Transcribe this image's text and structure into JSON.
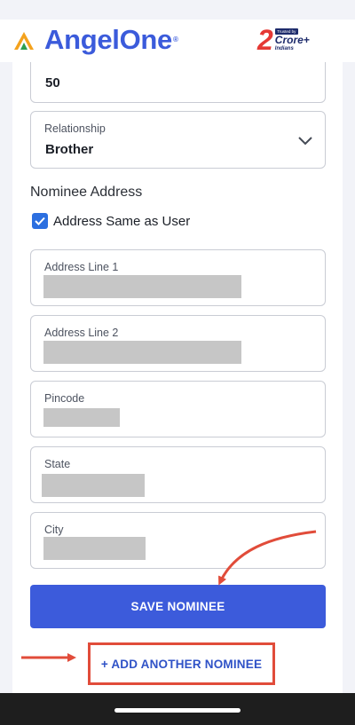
{
  "header": {
    "logo_text": "AngelOne",
    "logo_reg": "®",
    "badge": {
      "number": "2",
      "trusted": "Trusted by",
      "crore": "Crore+",
      "indians": "Indians"
    }
  },
  "form": {
    "share_value": "50",
    "relationship": {
      "label": "Relationship",
      "value": "Brother"
    },
    "address_section_title": "Nominee Address",
    "same_as_user": {
      "label": "Address Same as User",
      "checked": true
    },
    "fields": {
      "address_line_1": {
        "label": "Address Line 1"
      },
      "address_line_2": {
        "label": "Address Line 2"
      },
      "pincode": {
        "label": "Pincode"
      },
      "state": {
        "label": "State"
      },
      "city": {
        "label": "City"
      }
    },
    "save_button": "SAVE NOMINEE",
    "add_another": "+ ADD ANOTHER NOMINEE"
  },
  "colors": {
    "brand_blue": "#3c5bdb",
    "checkbox_blue": "#2c6fe0",
    "annotation_red": "#e14c3a"
  }
}
